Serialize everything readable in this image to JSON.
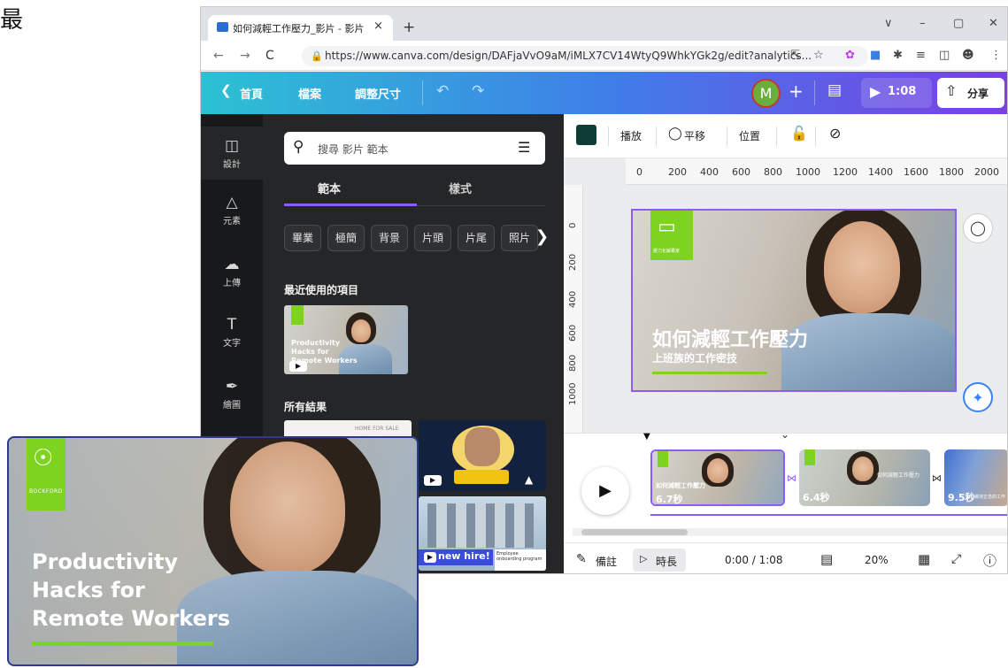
{
  "stray_char": "最",
  "browser": {
    "tab_title": "如何減輕工作壓力_影片 - 影片",
    "tab_close": "×",
    "new_tab": "+",
    "window_controls": [
      "∨",
      "–",
      "▢",
      "✕"
    ],
    "nav": [
      "←",
      "→",
      "C"
    ],
    "url": "https://www.canva.com/design/DAFjaVvO9aM/iMLX7CV14WtyQ9WhkYGk2g/edit?analytics...",
    "ext_icons": [
      "share-icon",
      "star-icon",
      "extension-icon",
      "puzzle-icon",
      "queue-icon",
      "sidepanel-icon",
      "profile-icon",
      "menu-icon"
    ]
  },
  "canva_bar": {
    "home": "首頁",
    "file": "檔案",
    "resize": "調整尺寸",
    "avatar": "M",
    "plus": "+",
    "duration": "1:08",
    "share": "分享"
  },
  "rail": [
    {
      "icon": "design-icon",
      "label": "設計"
    },
    {
      "icon": "elements-icon",
      "label": "元素"
    },
    {
      "icon": "upload-icon",
      "label": "上傳"
    },
    {
      "icon": "text-icon",
      "label": "文字"
    },
    {
      "icon": "draw-icon",
      "label": "繪圖"
    }
  ],
  "panel": {
    "search_placeholder": "搜尋 影片 範本",
    "tabs": [
      "範本",
      "樣式"
    ],
    "chips": [
      "畢業",
      "極簡",
      "背景",
      "片頭",
      "片尾",
      "照片"
    ],
    "recent_heading": "最近使用的項目",
    "all_results_heading": "所有結果",
    "recent_thumb_title": "Productivity Hacks for Remote Workers",
    "result_thumb_text": "new hire!",
    "result_thumb_sub": "Employee onboarding program",
    "home_sale_text": "HOME FOR SALE"
  },
  "toolbar": {
    "play": "播放",
    "pan": "平移",
    "position": "位置"
  },
  "ruler_h": [
    "0",
    "200",
    "400",
    "600",
    "800",
    "1000",
    "1200",
    "1400",
    "1600",
    "1800",
    "2000"
  ],
  "ruler_v": [
    "0",
    "200",
    "400",
    "600",
    "800",
    "1000"
  ],
  "design": {
    "logo_text": "壓力化解專家",
    "title": "如何減輕工作壓力",
    "subtitle": "上班族的工作密技"
  },
  "timeline": {
    "clips": [
      {
        "duration": "6.7秒",
        "title": "如何減輕工作壓力"
      },
      {
        "duration": "6.4秒",
        "title": "如何減輕工作壓力"
      },
      {
        "duration": "9.5秒",
        "title": "維持正念的工作"
      }
    ]
  },
  "bottom_bar": {
    "notes": "備註",
    "duration_label": "時長",
    "time": "0:00 / 1:08",
    "zoom": "20%"
  },
  "card": {
    "logo_text": "BOCKFORD",
    "title_lines": [
      "Productivity",
      "Hacks for",
      "Remote Workers"
    ]
  },
  "colors": {
    "accent_purple": "#8b5cf6",
    "brand_green": "#7ed321",
    "rail_bg": "#18191b",
    "panel_bg": "#252627"
  }
}
